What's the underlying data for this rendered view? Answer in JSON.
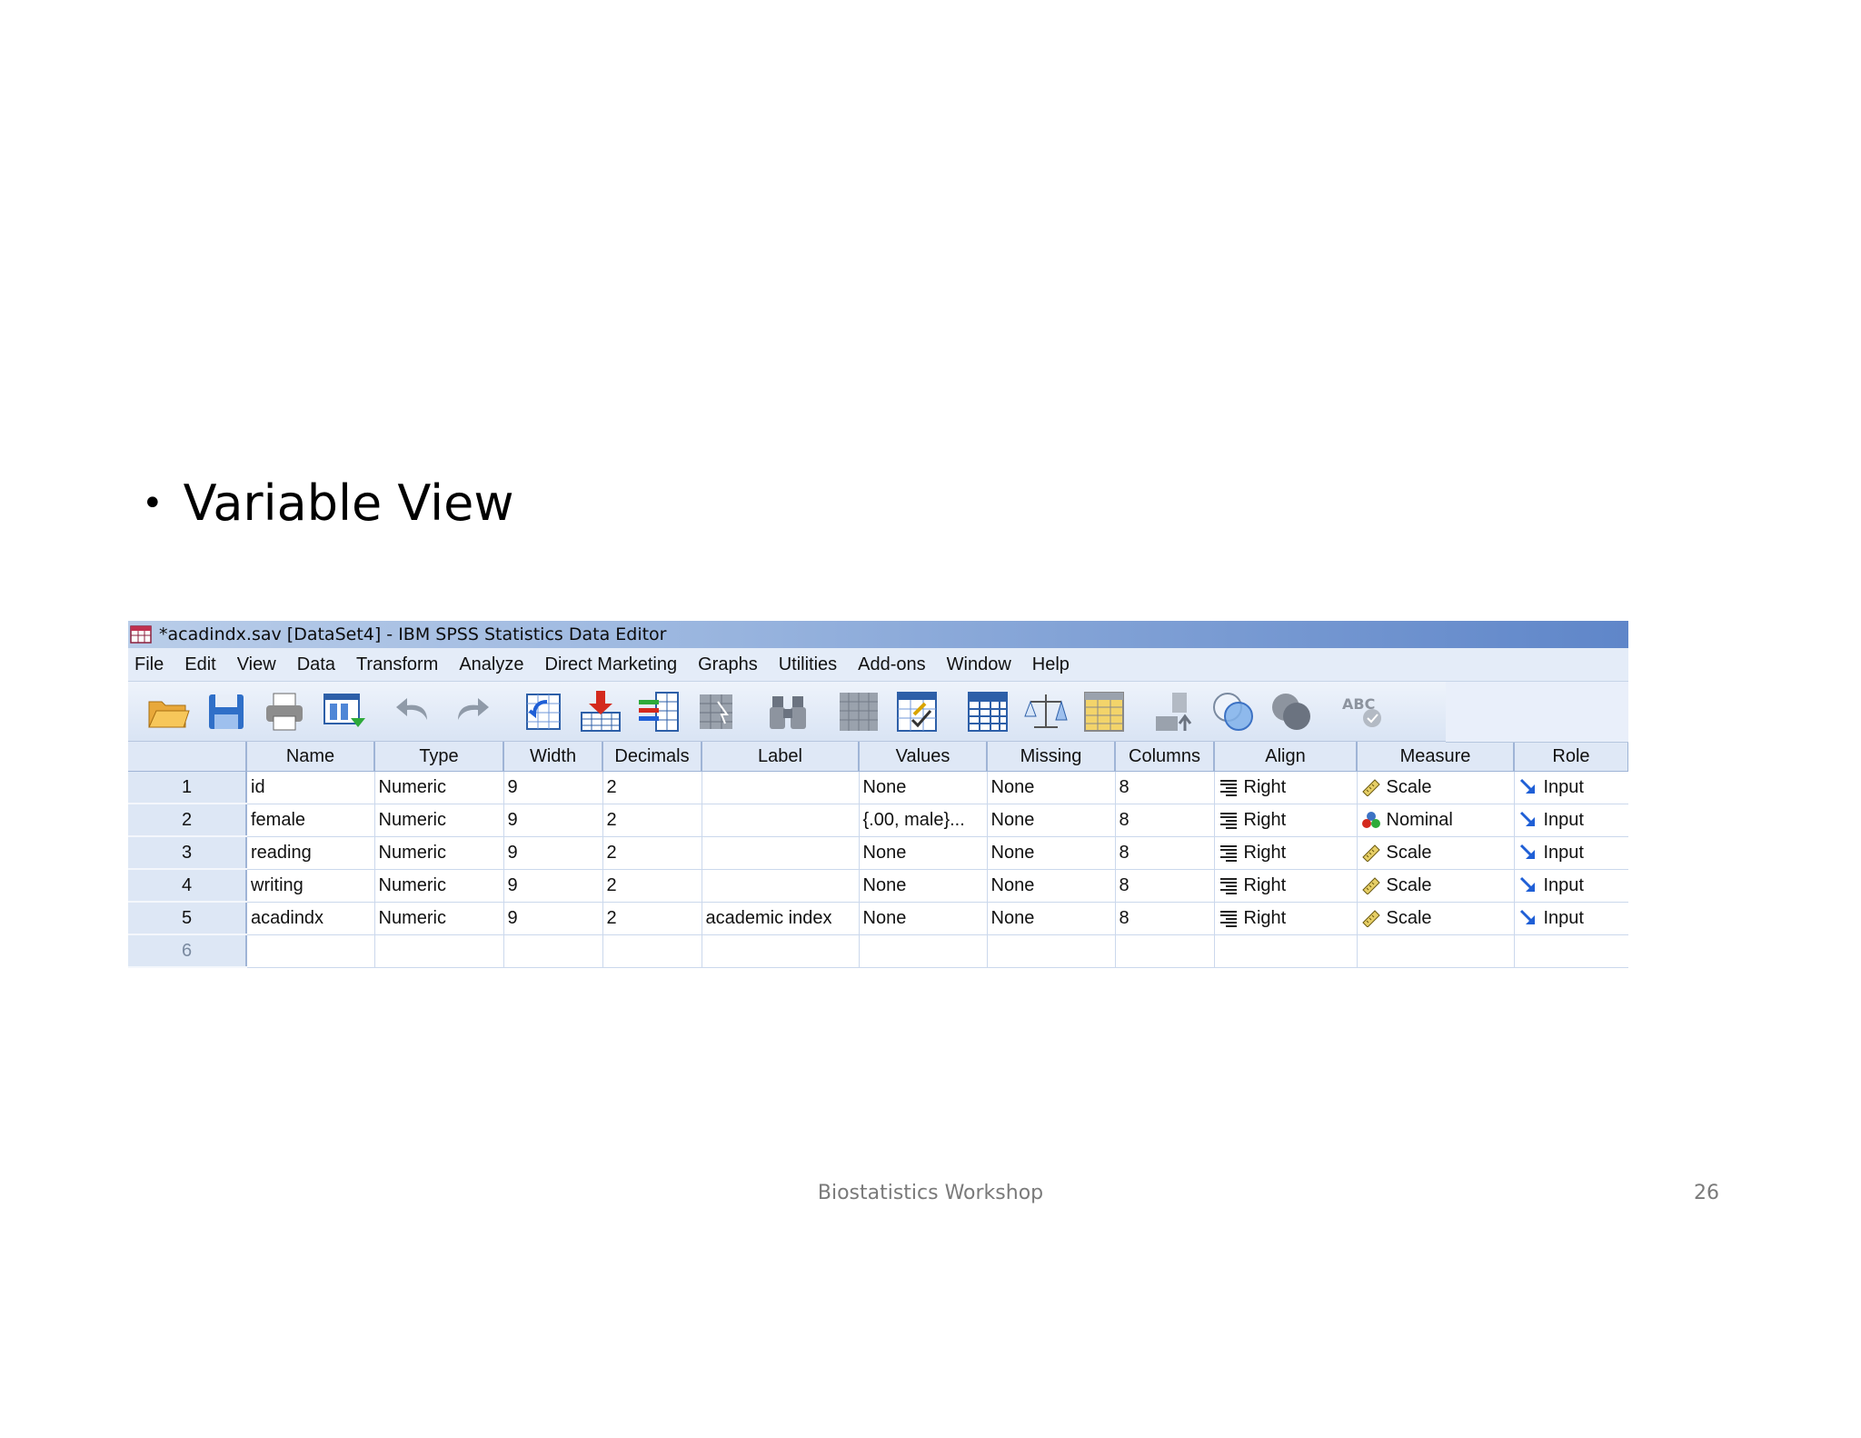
{
  "slide": {
    "bullet_text": "Variable View",
    "footer": "Biostatistics Workshop",
    "page_number": "26"
  },
  "window": {
    "title": "*acadindx.sav [DataSet4] - IBM SPSS Statistics Data Editor"
  },
  "menu": [
    "File",
    "Edit",
    "View",
    "Data",
    "Transform",
    "Analyze",
    "Direct Marketing",
    "Graphs",
    "Utilities",
    "Add-ons",
    "Window",
    "Help"
  ],
  "toolbar": [
    "open-folder-icon",
    "save-disk-icon",
    "print-icon",
    "recall-dialog-icon",
    "undo-icon",
    "redo-icon",
    "goto-case-icon",
    "goto-variable-icon",
    "variables-icon",
    "run-descriptives-icon",
    "find-binoculars-icon",
    "insert-cases-icon",
    "insert-variable-icon",
    "split-file-icon",
    "weight-cases-icon",
    "select-cases-icon",
    "value-labels-icon",
    "use-sets-icon",
    "show-all-variables-icon",
    "spell-check-icon"
  ],
  "grid": {
    "columns": [
      "Name",
      "Type",
      "Width",
      "Decimals",
      "Label",
      "Values",
      "Missing",
      "Columns",
      "Align",
      "Measure",
      "Role"
    ],
    "rows": [
      {
        "num": "1",
        "name": "id",
        "type": "Numeric",
        "width": "9",
        "decimals": "2",
        "label": "",
        "values": "None",
        "missing": "None",
        "columns": "8",
        "align": "Right",
        "measure": "Scale",
        "measure_icon": "ruler-icon",
        "role": "Input"
      },
      {
        "num": "2",
        "name": "female",
        "type": "Numeric",
        "width": "9",
        "decimals": "2",
        "label": "",
        "values": "{.00, male}...",
        "missing": "None",
        "columns": "8",
        "align": "Right",
        "measure": "Nominal",
        "measure_icon": "nominal-balls-icon",
        "role": "Input"
      },
      {
        "num": "3",
        "name": "reading",
        "type": "Numeric",
        "width": "9",
        "decimals": "2",
        "label": "",
        "values": "None",
        "missing": "None",
        "columns": "8",
        "align": "Right",
        "measure": "Scale",
        "measure_icon": "ruler-icon",
        "role": "Input"
      },
      {
        "num": "4",
        "name": "writing",
        "type": "Numeric",
        "width": "9",
        "decimals": "2",
        "label": "",
        "values": "None",
        "missing": "None",
        "columns": "8",
        "align": "Right",
        "measure": "Scale",
        "measure_icon": "ruler-icon",
        "role": "Input"
      },
      {
        "num": "5",
        "name": "acadindx",
        "type": "Numeric",
        "width": "9",
        "decimals": "2",
        "label": "academic index",
        "values": "None",
        "missing": "None",
        "columns": "8",
        "align": "Right",
        "measure": "Scale",
        "measure_icon": "ruler-icon",
        "role": "Input"
      }
    ],
    "empty_row_num": "6"
  },
  "colors": {
    "titlebar_end": "#5f86c9",
    "row_header": "#dde7f5",
    "grid_line": "#cbd8ec",
    "role_arrow": "#1f5fd6"
  }
}
